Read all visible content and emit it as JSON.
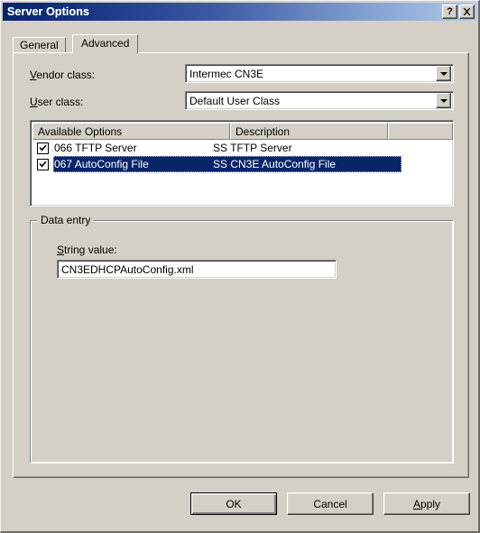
{
  "window": {
    "title": "Server Options",
    "help_button": "?",
    "close_button": "✕"
  },
  "tabs": [
    {
      "label": "General",
      "active": false
    },
    {
      "label": "Advanced",
      "active": true
    }
  ],
  "fields": {
    "vendor_class": {
      "label_prefix": "V",
      "label_rest": "endor class:",
      "value": "Intermec CN3E"
    },
    "user_class": {
      "label_prefix": "U",
      "label_rest": "ser class:",
      "value": "Default User Class"
    }
  },
  "list": {
    "columns": [
      "Available Options",
      "Description",
      ""
    ],
    "rows": [
      {
        "checked": true,
        "name": "066 TFTP Server",
        "description": "SS TFTP Server",
        "selected": false
      },
      {
        "checked": true,
        "name": "067 AutoConfig File",
        "description": "SS CN3E AutoConfig File",
        "selected": true
      }
    ]
  },
  "data_entry": {
    "group_title": "Data entry",
    "string_label_prefix": "S",
    "string_label_rest": "tring value:",
    "string_value": "CN3EDHCPAutoConfig.xml"
  },
  "buttons": {
    "ok": "OK",
    "cancel": "Cancel",
    "apply_prefix": "A",
    "apply_rest": "pply"
  },
  "colors": {
    "dialog_face": "#d4d0c8",
    "title_left": "#0a246a",
    "title_right": "#b4c9e8",
    "selection": "#0a246a",
    "field_bg": "#ffffff"
  }
}
